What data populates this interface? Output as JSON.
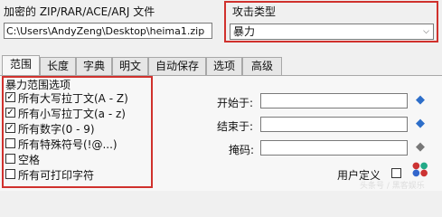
{
  "file": {
    "label": "加密的 ZIP/RAR/ACE/ARJ 文件",
    "path": "C:\\Users\\AndyZeng\\Desktop\\heima1.zip"
  },
  "attack": {
    "label": "攻击类型",
    "selected": "暴力"
  },
  "tabs": [
    "范围",
    "长度",
    "字典",
    "明文",
    "自动保存",
    "选项",
    "高级"
  ],
  "range": {
    "group_title": "暴力范围选项",
    "options": [
      {
        "label": "所有大写拉丁文(A - Z)",
        "checked": true
      },
      {
        "label": "所有小写拉丁文(a - z)",
        "checked": true
      },
      {
        "label": "所有数字(0 - 9)",
        "checked": true
      },
      {
        "label": "所有特殊符号(!@...)",
        "checked": false
      },
      {
        "label": "空格",
        "checked": false
      },
      {
        "label": "所有可打印字符",
        "checked": false
      }
    ]
  },
  "fields": {
    "start_label": "开始于:",
    "end_label": "结束于:",
    "mask_label": "掩码:",
    "user_defined_label": "用户定义"
  },
  "watermark": "头条号 / 黑客娱乐"
}
